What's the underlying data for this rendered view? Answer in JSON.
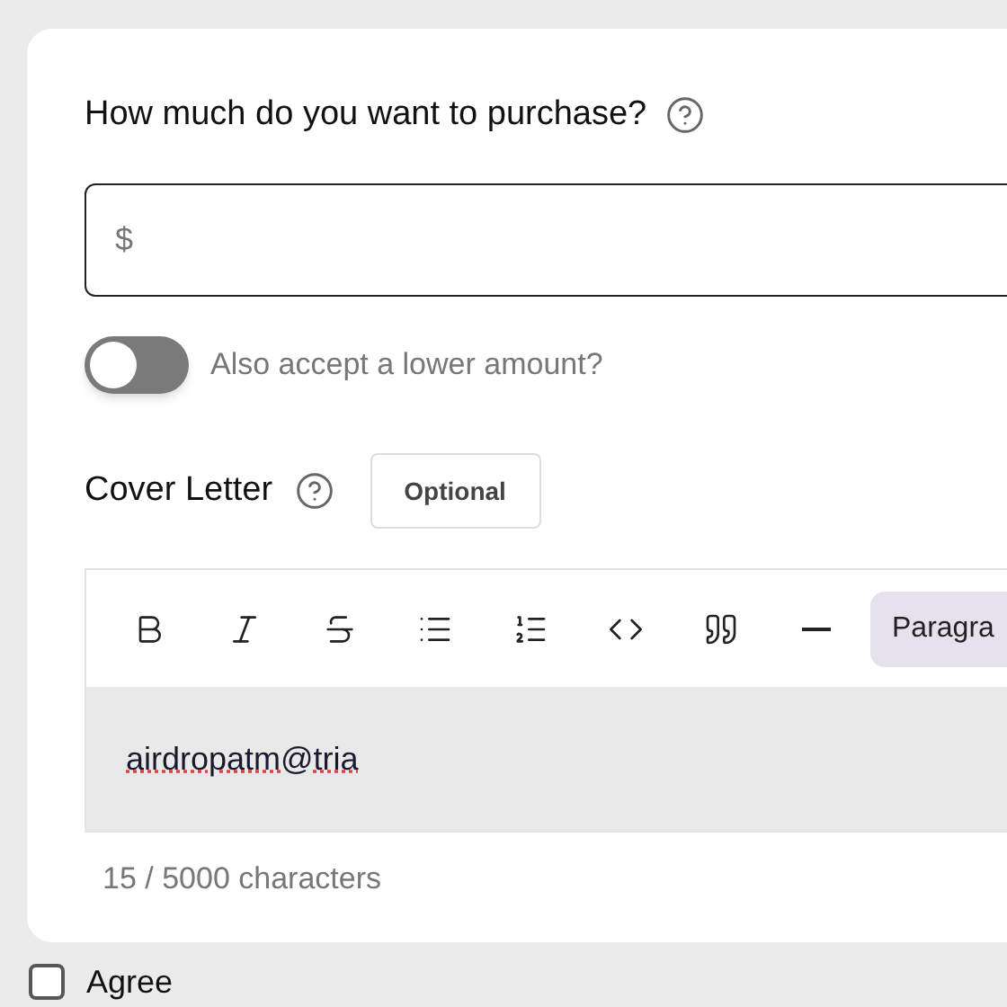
{
  "amount": {
    "label": "How much do you want to purchase?",
    "placeholder": "$"
  },
  "lower_amount": {
    "label": "Also accept a lower amount?",
    "on": false
  },
  "cover_letter": {
    "label": "Cover Letter",
    "badge": "Optional",
    "toolbar": [
      {
        "kind": "bold"
      },
      {
        "kind": "italic"
      },
      {
        "kind": "strike"
      },
      {
        "kind": "bullets"
      },
      {
        "kind": "numbers"
      },
      {
        "kind": "code"
      },
      {
        "kind": "quote"
      },
      {
        "kind": "rule"
      }
    ],
    "block_style": "Paragra",
    "value": "airdropatm@tria",
    "counter": "15 / 5000 characters"
  },
  "agree": {
    "label": "Agree",
    "checked": false
  }
}
